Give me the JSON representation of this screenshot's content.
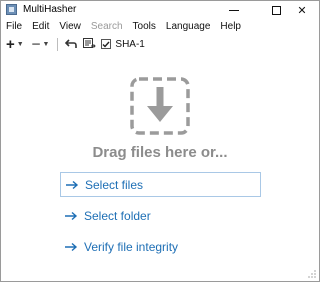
{
  "window": {
    "title": "MultiHasher",
    "controls": {
      "minimize_icon": "minimize-icon",
      "maximize_icon": "maximize-icon",
      "close_symbol": "✕"
    }
  },
  "menubar": {
    "items": [
      {
        "label": "File",
        "enabled": true
      },
      {
        "label": "Edit",
        "enabled": true
      },
      {
        "label": "View",
        "enabled": true
      },
      {
        "label": "Search",
        "enabled": false
      },
      {
        "label": "Tools",
        "enabled": true
      },
      {
        "label": "Language",
        "enabled": true
      },
      {
        "label": "Help",
        "enabled": true
      }
    ]
  },
  "toolbar": {
    "add_icon": "plus-icon",
    "remove_icon": "minus-icon",
    "back_icon": "undo-arrow-icon",
    "hash_list_icon": "hash-list-icon",
    "algorithm": {
      "label": "SHA-1",
      "checked": true
    }
  },
  "dropzone": {
    "icon": "download-arrow-icon",
    "text": "Drag files here or..."
  },
  "actions": [
    {
      "label": "Select files",
      "icon": "arrow-right-icon",
      "focused": true
    },
    {
      "label": "Select folder",
      "icon": "arrow-right-icon",
      "focused": false
    },
    {
      "label": "Verify file integrity",
      "icon": "arrow-right-icon",
      "focused": false
    }
  ],
  "colors": {
    "link": "#1e6fb5",
    "placeholder_text": "#8c8c8c",
    "disabled_menu": "#9a9a9a",
    "focus_border": "#a9c8e6"
  }
}
